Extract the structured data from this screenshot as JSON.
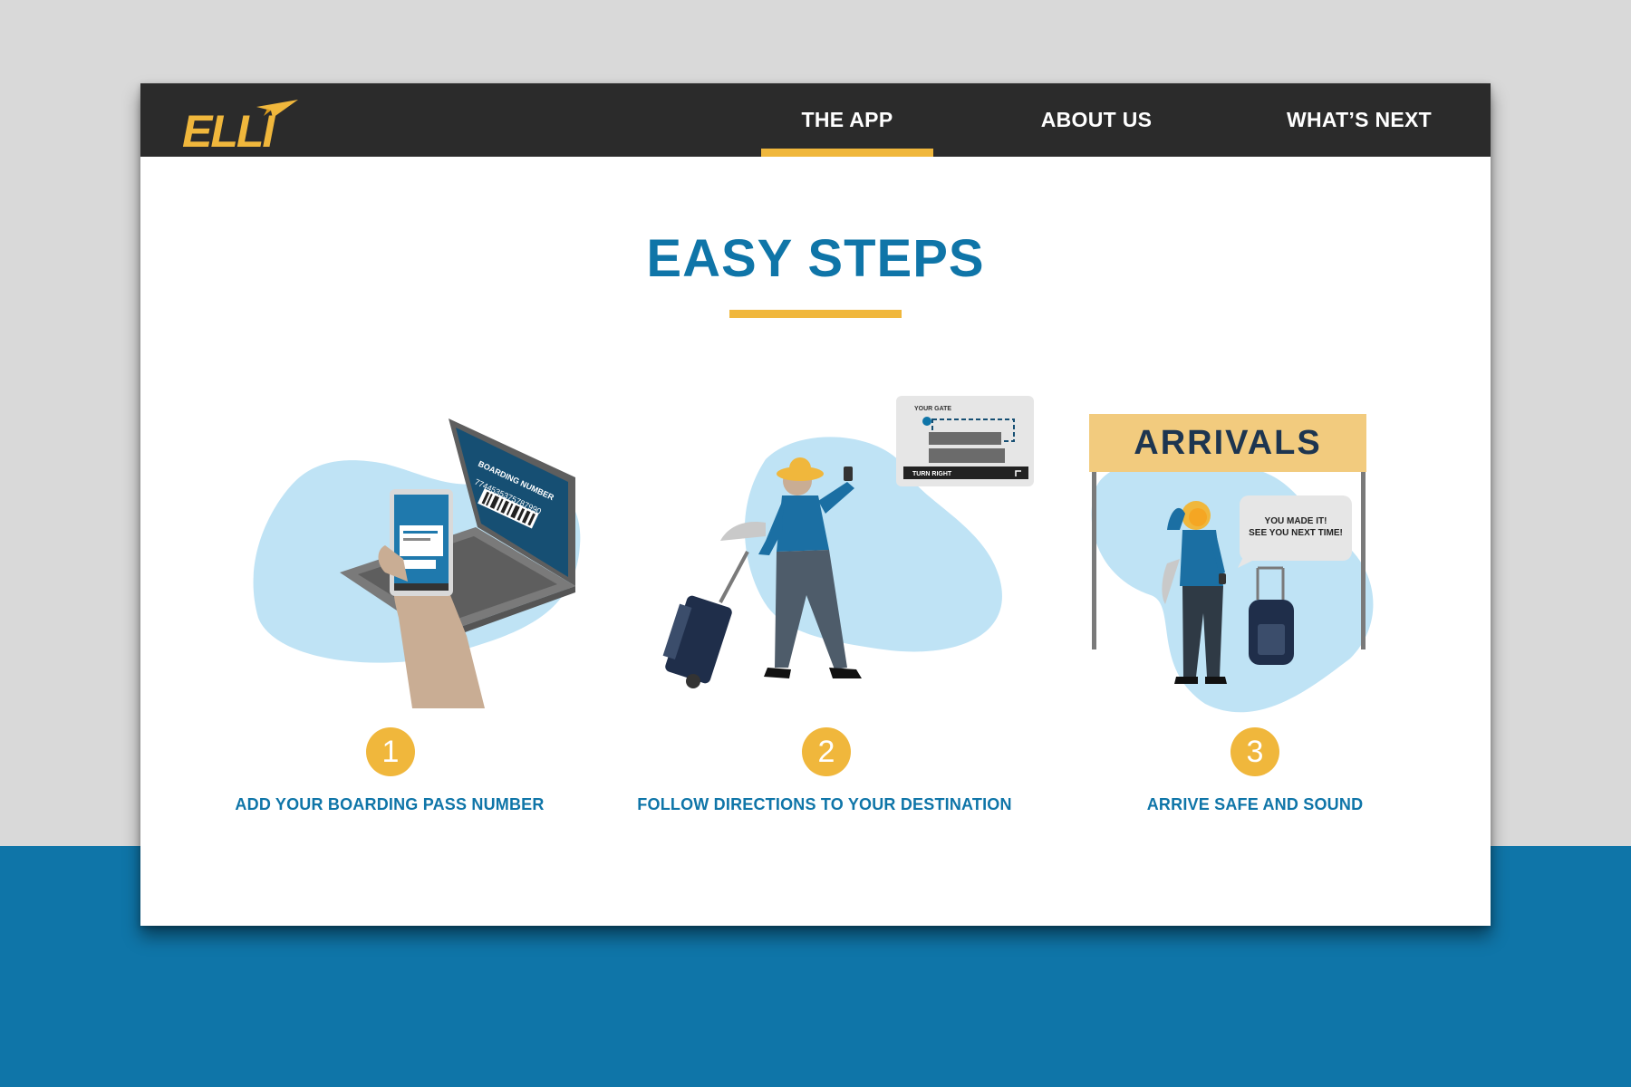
{
  "nav": {
    "logo_text": "ELLI",
    "items": [
      {
        "label": "THE APP",
        "active": true
      },
      {
        "label": "ABOUT US",
        "active": false
      },
      {
        "label": "WHAT’S NEXT",
        "active": false
      }
    ]
  },
  "main": {
    "title": "EASY STEPS",
    "steps": [
      {
        "number": "1",
        "label": "ADD YOUR BOARDING PASS NUMBER",
        "illustration": {
          "laptop_heading": "BOARDING NUMBER",
          "laptop_number": "7744535375787990"
        }
      },
      {
        "number": "2",
        "label": "FOLLOW DIRECTIONS TO YOUR DESTINATION",
        "illustration": {
          "map_heading": "YOUR GATE",
          "map_instruction": "TURN RIGHT"
        }
      },
      {
        "number": "3",
        "label": "ARRIVE SAFE AND SOUND",
        "illustration": {
          "sign_text": "ARRIVALS",
          "bubble_line1": "YOU MADE IT!",
          "bubble_line2": "SEE YOU NEXT TIME!"
        }
      }
    ]
  },
  "colors": {
    "brand_blue": "#0f75a8",
    "accent_yellow": "#f0b73c",
    "topbar": "#2b2b2b",
    "illustration_blob": "#bfe3f5"
  }
}
